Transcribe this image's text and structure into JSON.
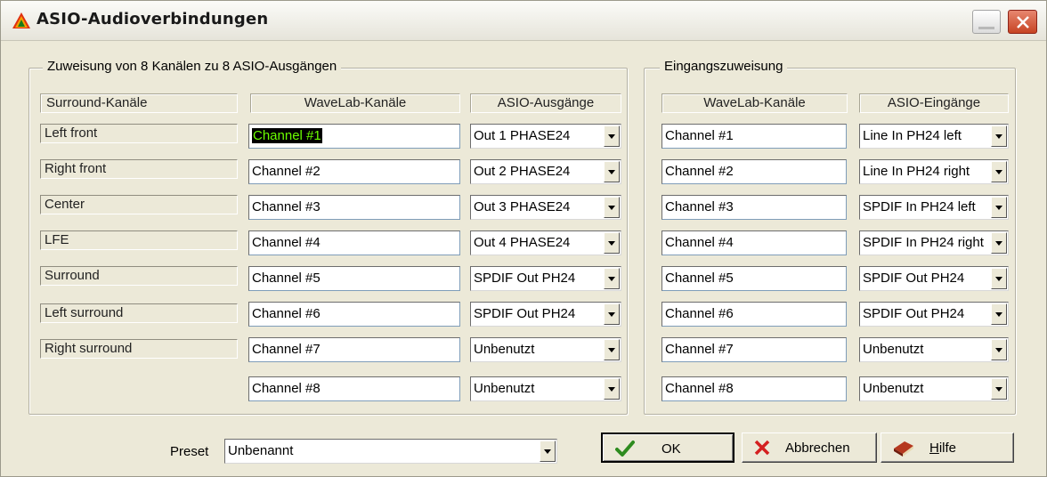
{
  "window": {
    "title": "ASIO-Audioverbindungen"
  },
  "outputs": {
    "legend": "Zuweisung von 8 Kanälen zu 8 ASIO-Ausgängen",
    "headers": {
      "surround": "Surround-Kanäle",
      "wavelab": "WaveLab-Kanäle",
      "asio": "ASIO-Ausgänge"
    },
    "surround_channels": [
      "Left front",
      "Right front",
      "Center",
      "LFE",
      "Surround",
      "Left surround",
      "Right surround"
    ],
    "wavelab_channels": [
      "Channel #1",
      "Channel #2",
      "Channel #3",
      "Channel #4",
      "Channel #5",
      "Channel #6",
      "Channel #7",
      "Channel #8"
    ],
    "asio_outputs": [
      "Out 1 PHASE24",
      "Out 2 PHASE24",
      "Out 3 PHASE24",
      "Out 4 PHASE24",
      "SPDIF Out PH24",
      "SPDIF Out PH24",
      "Unbenutzt",
      "Unbenutzt"
    ]
  },
  "inputs": {
    "legend": "Eingangszuweisung",
    "headers": {
      "wavelab": "WaveLab-Kanäle",
      "asio": "ASIO-Eingänge"
    },
    "wavelab_channels": [
      "Channel #1",
      "Channel #2",
      "Channel #3",
      "Channel #4",
      "Channel #5",
      "Channel #6",
      "Channel #7",
      "Channel #8"
    ],
    "asio_inputs": [
      "Line In PH24 left",
      "Line In PH24 right",
      "SPDIF In PH24 left",
      "SPDIF In PH24 right",
      "SPDIF Out PH24",
      "SPDIF Out PH24",
      "Unbenutzt",
      "Unbenutzt"
    ]
  },
  "footer": {
    "preset_label": "Preset",
    "preset_value": "Unbenannt",
    "ok_label": "OK",
    "cancel_label": "Abbrechen",
    "help_label": "Hilfe"
  },
  "colors": {
    "selection_text": "#6cff00",
    "ok_check": "#2e8b1f",
    "cancel_x": "#d42020",
    "close_button": "#c74423"
  },
  "icons": [
    "app-triangle-icon",
    "minimize-icon",
    "close-icon",
    "checkmark-icon",
    "cancel-x-icon",
    "help-book-icon",
    "chevron-down-icon"
  ]
}
